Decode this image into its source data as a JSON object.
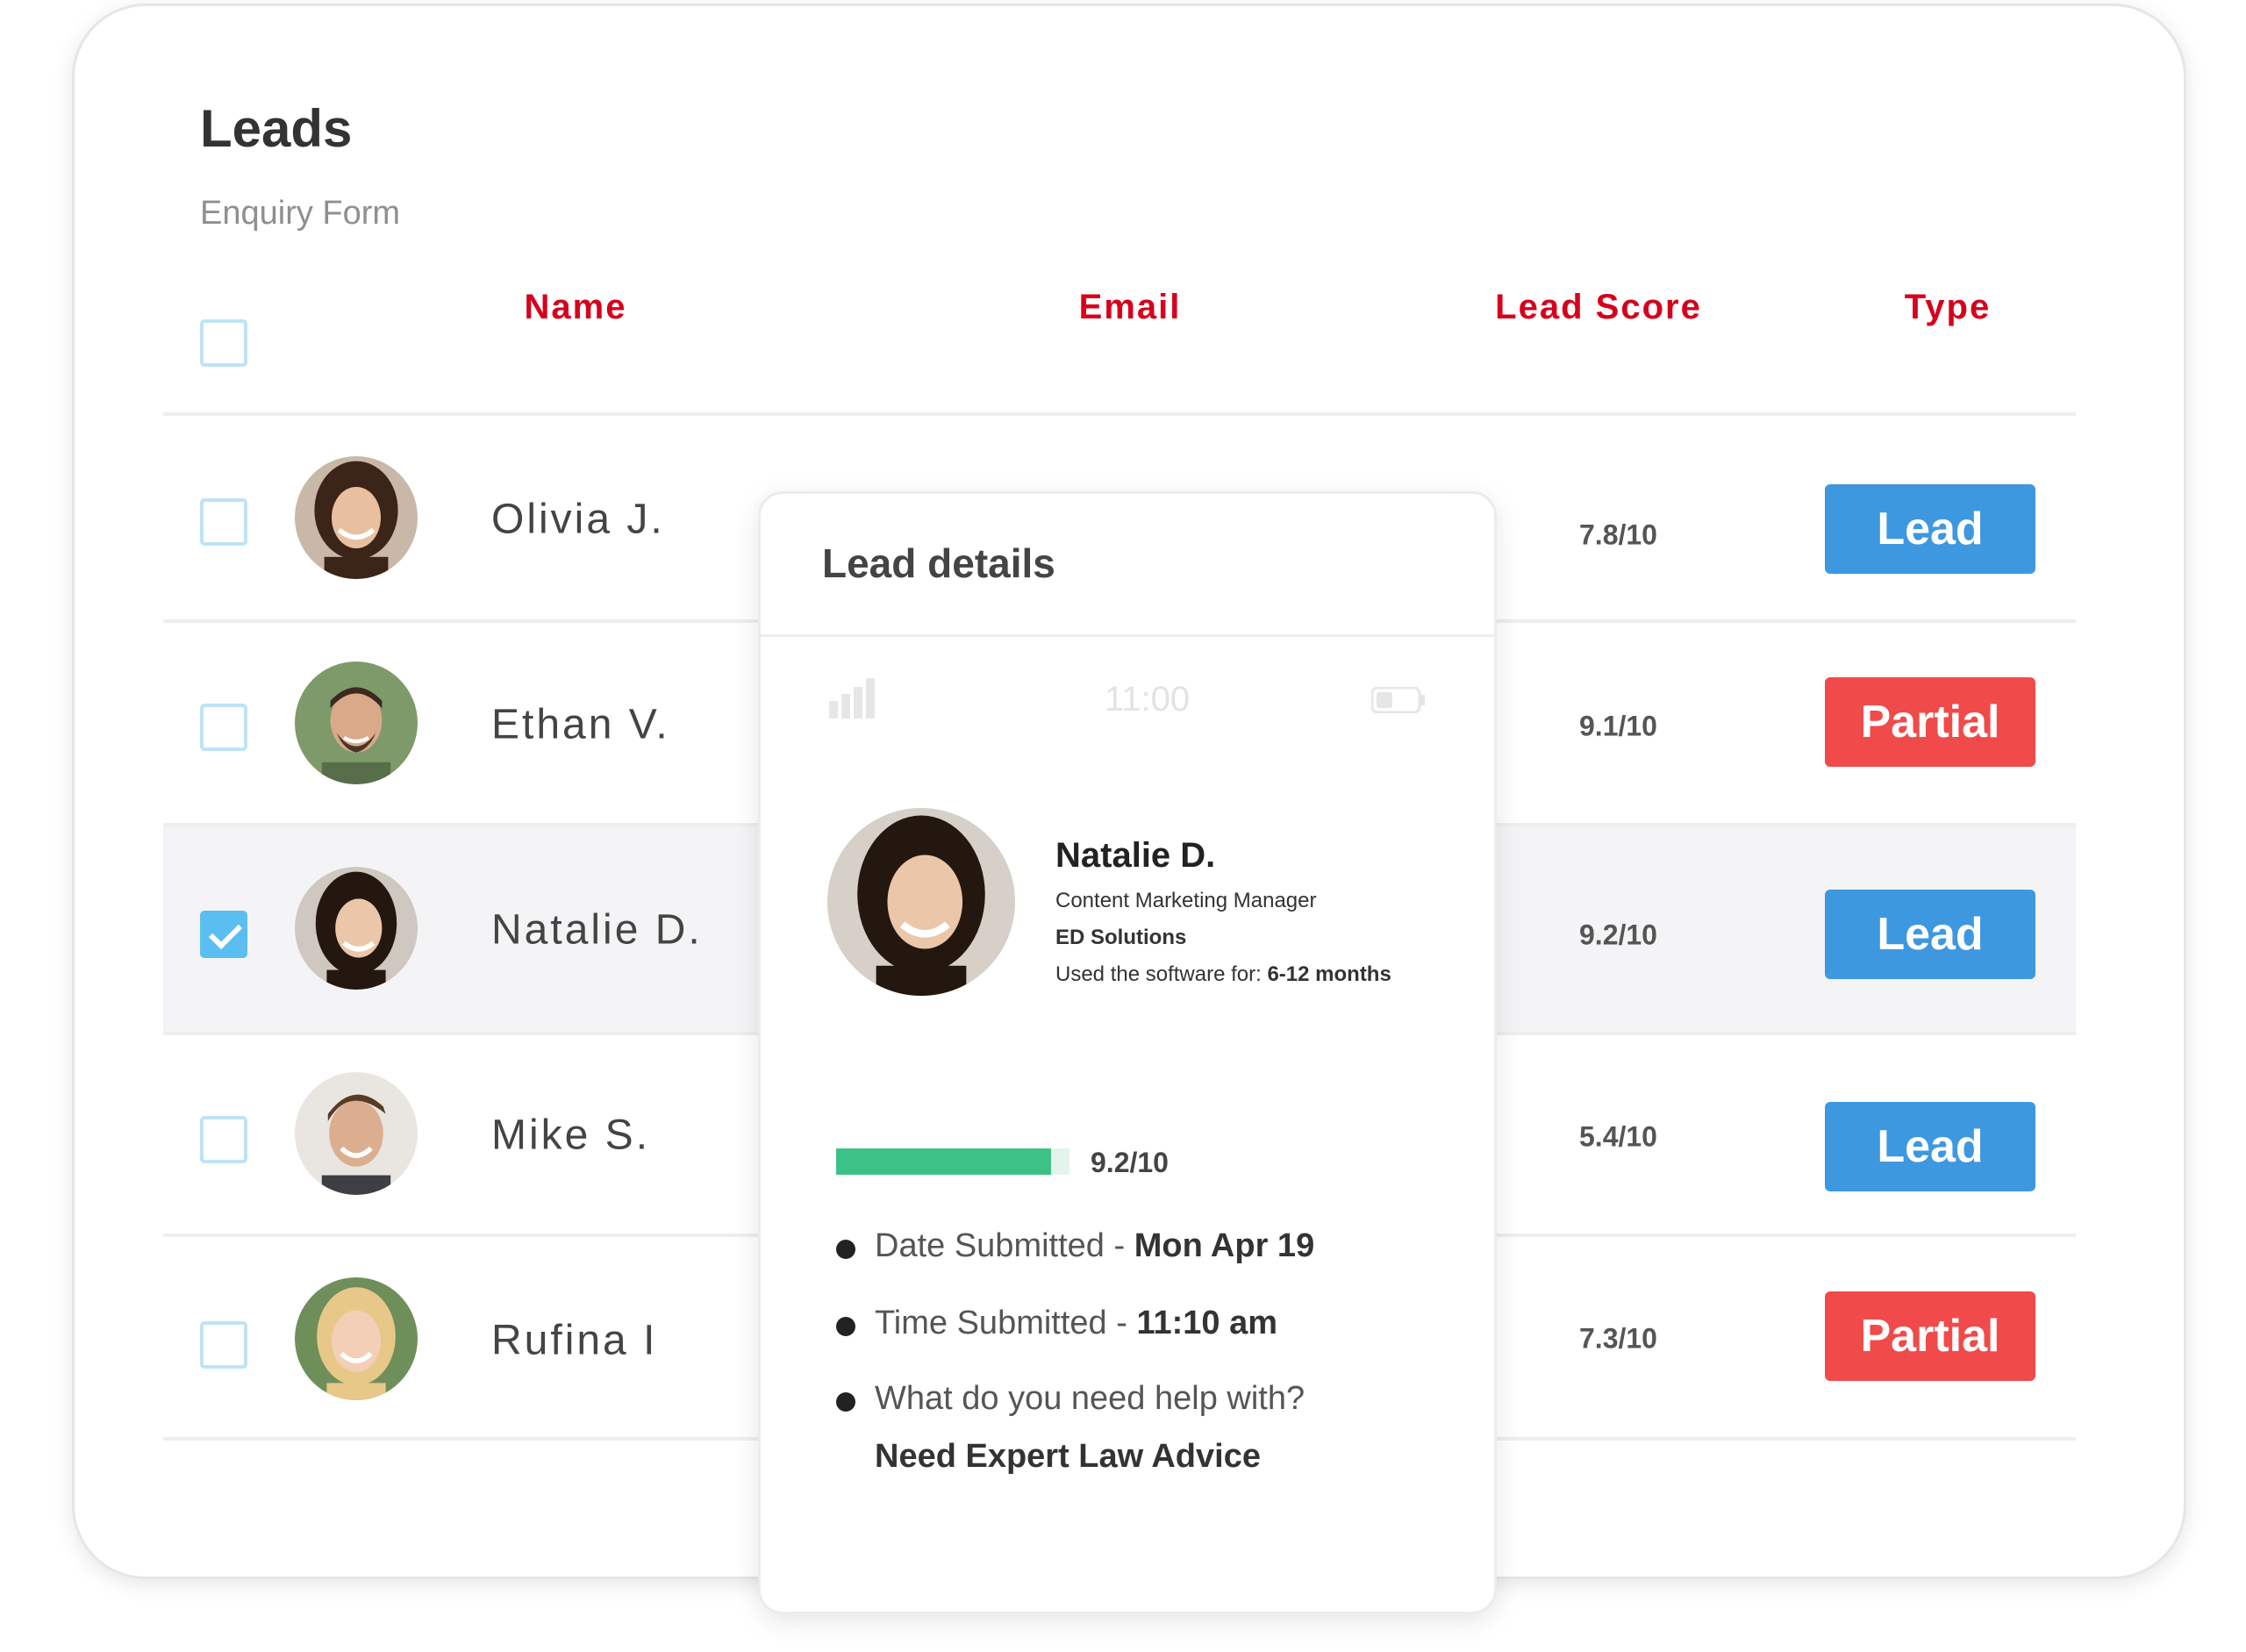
{
  "header": {
    "title": "Leads",
    "subtitle": "Enquiry Form"
  },
  "columns": {
    "name": "Name",
    "email": "Email",
    "lead_score": "Lead Score",
    "type": "Type"
  },
  "rows": [
    {
      "name": "Olivia J.",
      "score": "7.8/10",
      "type": "Lead",
      "checked": false
    },
    {
      "name": "Ethan V.",
      "score": "9.1/10",
      "type": "Partial",
      "checked": false
    },
    {
      "name": "Natalie D.",
      "score": "9.2/10",
      "type": "Lead",
      "checked": true
    },
    {
      "name": "Mike S.",
      "score": "5.4/10",
      "type": "Lead",
      "checked": false
    },
    {
      "name": "Rufina I",
      "score": "7.3/10",
      "type": "Partial",
      "checked": false
    }
  ],
  "popup": {
    "title": "Lead details",
    "status_time": "11:00",
    "name": "Natalie D.",
    "job_title": "Content Marketing Manager",
    "company": "ED Solutions",
    "usage_label": "Used the software for:",
    "usage_value": "6-12 months",
    "score_label": "9.2/10",
    "score_fraction": 0.92,
    "date_label": "Date Submitted -",
    "date_value": "Mon Apr 19",
    "time_label": "Time Submitted -",
    "time_value": "11:10 am",
    "question": "What do you need help with?",
    "answer": "Need Expert Law Advice"
  },
  "colors": {
    "accent_red": "#d6001c",
    "lead_blue": "#3d98e0",
    "partial_red": "#f04a4a",
    "checkbox_blue": "#5bbef0",
    "score_green": "#3cc287"
  }
}
